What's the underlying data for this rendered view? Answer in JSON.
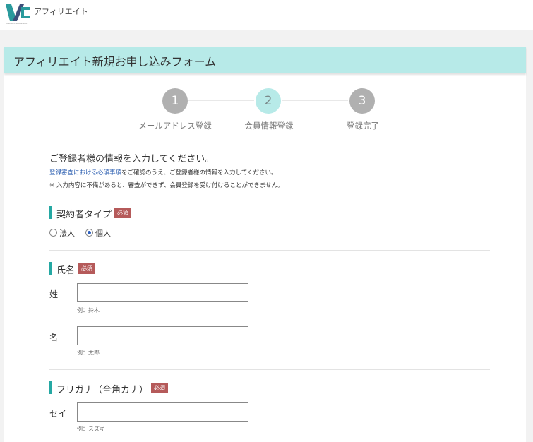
{
  "header": {
    "logo_text": "VALUECOMMERCE",
    "brand": "アフィリエイト"
  },
  "banner": {
    "title": "アフィリエイト新規お申し込みフォーム"
  },
  "steps": [
    {
      "number": "1",
      "label": "メールアドレス登録"
    },
    {
      "number": "2",
      "label": "会員情報登録"
    },
    {
      "number": "3",
      "label": "登録完了"
    }
  ],
  "intro": {
    "heading": "ご登録者様の情報を入力してください。",
    "link_text": "登録審査における必須事項",
    "line1_rest": "をご確認のうえ、ご登録者様の情報を入力してください。",
    "line2": "※ 入力内容に不備があると、審査ができず、会員登録を受け付けることができません。"
  },
  "required_label": "必須",
  "sections": {
    "contract_type": {
      "title": "契約者タイプ",
      "options": [
        {
          "label": "法人",
          "checked": false
        },
        {
          "label": "個人",
          "checked": true
        }
      ]
    },
    "name": {
      "title": "氏名",
      "last_label": "姓",
      "last_value": "",
      "last_hint": "例：鈴木",
      "first_label": "名",
      "first_value": "",
      "first_hint": "例：太郎"
    },
    "furigana": {
      "title": "フリガナ（全角カナ）",
      "sei_label": "セイ",
      "sei_value": "",
      "sei_hint": "例：スズキ"
    }
  },
  "colors": {
    "banner": "#b7eae8",
    "accent": "#25a8a3",
    "required_badge": "#b55a5a",
    "step_inactive": "#b0b0b0",
    "link": "#2a5db0"
  }
}
